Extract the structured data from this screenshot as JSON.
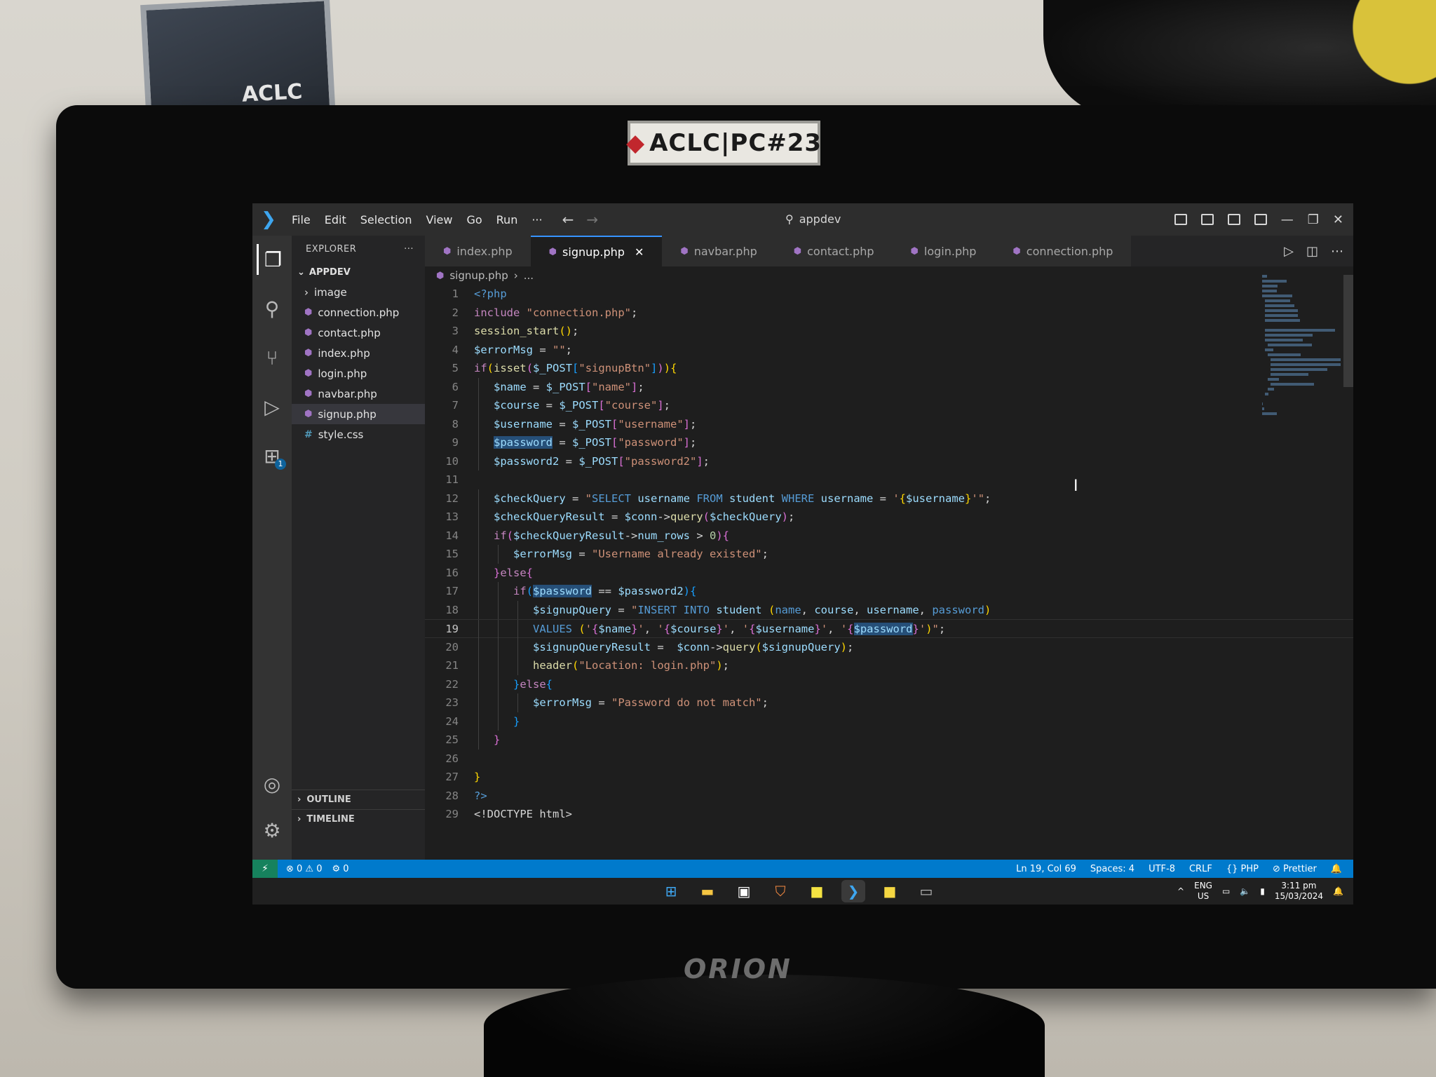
{
  "room": {
    "pc_label": "ACLC|PC#23",
    "monitor_brand": "ORION",
    "poster_text": "ACLC"
  },
  "titlebar": {
    "menu": [
      "File",
      "Edit",
      "Selection",
      "View",
      "Go",
      "Run",
      "···"
    ],
    "search": "appdev"
  },
  "explorer": {
    "title": "EXPLORER",
    "more": "···",
    "folder": "APPDEV",
    "items": [
      {
        "label": "image",
        "type": "folder"
      },
      {
        "label": "connection.php",
        "type": "php"
      },
      {
        "label": "contact.php",
        "type": "php"
      },
      {
        "label": "index.php",
        "type": "php"
      },
      {
        "label": "login.php",
        "type": "php"
      },
      {
        "label": "navbar.php",
        "type": "php"
      },
      {
        "label": "signup.php",
        "type": "php",
        "active": true
      },
      {
        "label": "style.css",
        "type": "css"
      }
    ],
    "outline": "OUTLINE",
    "timeline": "TIMELINE"
  },
  "tabs": [
    {
      "label": "index.php"
    },
    {
      "label": "signup.php",
      "active": true
    },
    {
      "label": "navbar.php"
    },
    {
      "label": "contact.php"
    },
    {
      "label": "login.php"
    },
    {
      "label": "connection.php"
    }
  ],
  "breadcrumb": {
    "file": "signup.php",
    "rest": "..."
  },
  "current_line": 19,
  "code": [
    {
      "n": 1,
      "i": 0,
      "t": [
        [
          "php",
          "<?php"
        ]
      ]
    },
    {
      "n": 2,
      "i": 0,
      "t": [
        [
          "kw",
          "include"
        ],
        [
          "txt",
          " "
        ],
        [
          "str",
          "\"connection.php\""
        ],
        [
          "txt",
          ";"
        ]
      ]
    },
    {
      "n": 3,
      "i": 0,
      "t": [
        [
          "fn",
          "session_start"
        ],
        [
          "br1",
          "()"
        ],
        [
          "txt",
          ";"
        ]
      ]
    },
    {
      "n": 4,
      "i": 0,
      "t": [
        [
          "var",
          "$errorMsg"
        ],
        [
          "txt",
          " = "
        ],
        [
          "str",
          "\"\""
        ],
        [
          "txt",
          ";"
        ]
      ]
    },
    {
      "n": 5,
      "i": 0,
      "t": [
        [
          "ctl",
          "if"
        ],
        [
          "br1",
          "("
        ],
        [
          "fn",
          "isset"
        ],
        [
          "br2",
          "("
        ],
        [
          "var",
          "$_POST"
        ],
        [
          "br3",
          "["
        ],
        [
          "str",
          "\"signupBtn\""
        ],
        [
          "br3",
          "]"
        ],
        [
          "br2",
          ")"
        ],
        [
          "br1",
          ")"
        ],
        [
          "br1",
          "{"
        ]
      ]
    },
    {
      "n": 6,
      "i": 1,
      "t": [
        [
          "var",
          "$name"
        ],
        [
          "txt",
          " = "
        ],
        [
          "var",
          "$_POST"
        ],
        [
          "br2",
          "["
        ],
        [
          "str",
          "\"name\""
        ],
        [
          "br2",
          "]"
        ],
        [
          "txt",
          ";"
        ]
      ]
    },
    {
      "n": 7,
      "i": 1,
      "t": [
        [
          "var",
          "$course"
        ],
        [
          "txt",
          " = "
        ],
        [
          "var",
          "$_POST"
        ],
        [
          "br2",
          "["
        ],
        [
          "str",
          "\"course\""
        ],
        [
          "br2",
          "]"
        ],
        [
          "txt",
          ";"
        ]
      ]
    },
    {
      "n": 8,
      "i": 1,
      "t": [
        [
          "var",
          "$username"
        ],
        [
          "txt",
          " = "
        ],
        [
          "var",
          "$_POST"
        ],
        [
          "br2",
          "["
        ],
        [
          "str",
          "\"username\""
        ],
        [
          "br2",
          "]"
        ],
        [
          "txt",
          ";"
        ]
      ]
    },
    {
      "n": 9,
      "i": 1,
      "t": [
        [
          "varhl",
          "$password"
        ],
        [
          "txt",
          " = "
        ],
        [
          "var",
          "$_POST"
        ],
        [
          "br2",
          "["
        ],
        [
          "str",
          "\"password\""
        ],
        [
          "br2",
          "]"
        ],
        [
          "txt",
          ";"
        ]
      ]
    },
    {
      "n": 10,
      "i": 1,
      "t": [
        [
          "var",
          "$password2"
        ],
        [
          "txt",
          " = "
        ],
        [
          "var",
          "$_POST"
        ],
        [
          "br2",
          "["
        ],
        [
          "str",
          "\"password2\""
        ],
        [
          "br2",
          "]"
        ],
        [
          "txt",
          ";"
        ]
      ]
    },
    {
      "n": 11,
      "i": 0,
      "t": []
    },
    {
      "n": 12,
      "i": 1,
      "t": [
        [
          "var",
          "$checkQuery"
        ],
        [
          "txt",
          " = "
        ],
        [
          "str",
          "\""
        ],
        [
          "sql",
          "SELECT"
        ],
        [
          "var",
          " username "
        ],
        [
          "sql",
          "FROM"
        ],
        [
          "var",
          " student "
        ],
        [
          "sql",
          "WHERE"
        ],
        [
          "var",
          " username "
        ],
        [
          "txt",
          "= "
        ],
        [
          "str",
          "'"
        ],
        [
          "br1",
          "{"
        ],
        [
          "var",
          "$username"
        ],
        [
          "br1",
          "}"
        ],
        [
          "str",
          "'\""
        ],
        [
          "txt",
          ";"
        ]
      ]
    },
    {
      "n": 13,
      "i": 1,
      "t": [
        [
          "var",
          "$checkQueryResult"
        ],
        [
          "txt",
          " = "
        ],
        [
          "var",
          "$conn"
        ],
        [
          "txt",
          "->"
        ],
        [
          "fn",
          "query"
        ],
        [
          "br2",
          "("
        ],
        [
          "var",
          "$checkQuery"
        ],
        [
          "br2",
          ")"
        ],
        [
          "txt",
          ";"
        ]
      ]
    },
    {
      "n": 14,
      "i": 1,
      "t": [
        [
          "ctl",
          "if"
        ],
        [
          "br2",
          "("
        ],
        [
          "var",
          "$checkQueryResult"
        ],
        [
          "txt",
          "->"
        ],
        [
          "var",
          "num_rows"
        ],
        [
          "txt",
          " > "
        ],
        [
          "num",
          "0"
        ],
        [
          "br2",
          ")"
        ],
        [
          "br2",
          "{"
        ]
      ]
    },
    {
      "n": 15,
      "i": 2,
      "t": [
        [
          "var",
          "$errorMsg"
        ],
        [
          "txt",
          " = "
        ],
        [
          "str",
          "\"Username already existed\""
        ],
        [
          "txt",
          ";"
        ]
      ]
    },
    {
      "n": 16,
      "i": 1,
      "t": [
        [
          "br2",
          "}"
        ],
        [
          "ctl",
          "else"
        ],
        [
          "br2",
          "{"
        ]
      ]
    },
    {
      "n": 17,
      "i": 2,
      "t": [
        [
          "ctl",
          "if"
        ],
        [
          "br3",
          "("
        ],
        [
          "varhl",
          "$password"
        ],
        [
          "txt",
          " == "
        ],
        [
          "var",
          "$password2"
        ],
        [
          "br3",
          ")"
        ],
        [
          "br3",
          "{"
        ]
      ]
    },
    {
      "n": 18,
      "i": 3,
      "t": [
        [
          "var",
          "$signupQuery"
        ],
        [
          "txt",
          " = "
        ],
        [
          "str",
          "\""
        ],
        [
          "sql",
          "INSERT INTO"
        ],
        [
          "var",
          " student "
        ],
        [
          "br1",
          "("
        ],
        [
          "sql",
          "name"
        ],
        [
          "txt",
          ", "
        ],
        [
          "var",
          "course"
        ],
        [
          "txt",
          ", "
        ],
        [
          "var",
          "username"
        ],
        [
          "txt",
          ", "
        ],
        [
          "sql",
          "password"
        ],
        [
          "br1",
          ")"
        ]
      ]
    },
    {
      "n": 19,
      "i": 3,
      "t": [
        [
          "sql",
          "VALUES"
        ],
        [
          "txt",
          " "
        ],
        [
          "br1",
          "("
        ],
        [
          "str",
          "'"
        ],
        [
          "br2",
          "{"
        ],
        [
          "var",
          "$name"
        ],
        [
          "br2",
          "}"
        ],
        [
          "str",
          "'"
        ],
        [
          "txt",
          ", "
        ],
        [
          "str",
          "'"
        ],
        [
          "br2",
          "{"
        ],
        [
          "var",
          "$course"
        ],
        [
          "br2",
          "}"
        ],
        [
          "str",
          "'"
        ],
        [
          "txt",
          ", "
        ],
        [
          "str",
          "'"
        ],
        [
          "br2",
          "{"
        ],
        [
          "var",
          "$username"
        ],
        [
          "br2",
          "}"
        ],
        [
          "str",
          "'"
        ],
        [
          "txt",
          ", "
        ],
        [
          "str",
          "'"
        ],
        [
          "br2",
          "{"
        ],
        [
          "varhl",
          "$password"
        ],
        [
          "br2",
          "}"
        ],
        [
          "str",
          "'"
        ],
        [
          "br1",
          ")"
        ],
        [
          "str",
          "\""
        ],
        [
          "txt",
          ";"
        ]
      ]
    },
    {
      "n": 20,
      "i": 3,
      "t": [
        [
          "var",
          "$signupQueryResult"
        ],
        [
          "txt",
          " =  "
        ],
        [
          "var",
          "$conn"
        ],
        [
          "txt",
          "->"
        ],
        [
          "fn",
          "query"
        ],
        [
          "br1",
          "("
        ],
        [
          "var",
          "$signupQuery"
        ],
        [
          "br1",
          ")"
        ],
        [
          "txt",
          ";"
        ]
      ]
    },
    {
      "n": 21,
      "i": 3,
      "t": [
        [
          "fn",
          "header"
        ],
        [
          "br1",
          "("
        ],
        [
          "str",
          "\"Location: login.php\""
        ],
        [
          "br1",
          ")"
        ],
        [
          "txt",
          ";"
        ]
      ]
    },
    {
      "n": 22,
      "i": 2,
      "t": [
        [
          "br3",
          "}"
        ],
        [
          "ctl",
          "else"
        ],
        [
          "br3",
          "{"
        ]
      ]
    },
    {
      "n": 23,
      "i": 3,
      "t": [
        [
          "var",
          "$errorMsg"
        ],
        [
          "txt",
          " = "
        ],
        [
          "str",
          "\"Password do not match\""
        ],
        [
          "txt",
          ";"
        ]
      ]
    },
    {
      "n": 24,
      "i": 2,
      "t": [
        [
          "br3",
          "}"
        ]
      ]
    },
    {
      "n": 25,
      "i": 1,
      "t": [
        [
          "br2",
          "}"
        ]
      ]
    },
    {
      "n": 26,
      "i": 0,
      "t": []
    },
    {
      "n": 27,
      "i": 0,
      "t": [
        [
          "br1",
          "}"
        ]
      ]
    },
    {
      "n": 28,
      "i": 0,
      "t": [
        [
          "php",
          "?>"
        ]
      ]
    },
    {
      "n": 29,
      "i": 0,
      "t": [
        [
          "txt",
          "<!DOCTYPE html>"
        ]
      ]
    }
  ],
  "statusbar": {
    "remote": "⚡",
    "problems": "⊗ 0 ⚠ 0",
    "ports": "⚙ 0",
    "position": "Ln 19, Col 69",
    "spaces": "Spaces: 4",
    "encoding": "UTF-8",
    "eol": "CRLF",
    "language": "{} PHP",
    "formatter": "⊘ Prettier"
  },
  "taskbar": {
    "lang_top": "ENG",
    "lang_bottom": "US",
    "time": "3:11 pm",
    "date": "15/03/2024"
  },
  "colors": {
    "accent": "#007acc",
    "editor_bg": "#1e1e1e",
    "sidebar_bg": "#252526"
  }
}
